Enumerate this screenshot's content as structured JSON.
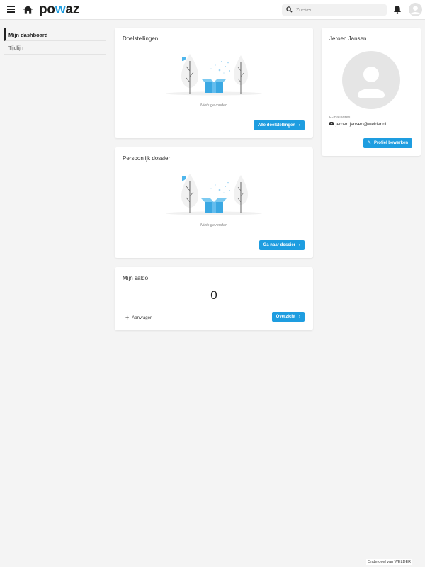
{
  "header": {
    "logo_text_1": "po",
    "logo_text_2": "w",
    "logo_text_3": "az",
    "search_placeholder": "Zoeken...",
    "brand_color": "#1e9de0"
  },
  "sidebar": {
    "items": [
      {
        "label": "Mijn dashboard",
        "active": true
      },
      {
        "label": "Tijdlijn",
        "active": false
      }
    ]
  },
  "goals_card": {
    "title": "Doelstellingen",
    "empty_text": "Niets gevonden",
    "button_label": "Alle doelstellingen"
  },
  "dossier_card": {
    "title": "Persoonlijk dossier",
    "empty_text": "Niets gevonden",
    "button_label": "Ga naar dossier"
  },
  "saldo_card": {
    "title": "Mijn saldo",
    "value": "0",
    "request_label": "Aanvragen",
    "button_label": "Overzicht"
  },
  "profile_card": {
    "name": "Jeroen Jansen",
    "email_label": "E-mailadres",
    "email": "jeroen.jansen@welder.nl",
    "button_label": "Profiel bewerken"
  },
  "footer": {
    "text": "Onderdeel van WELDER"
  }
}
